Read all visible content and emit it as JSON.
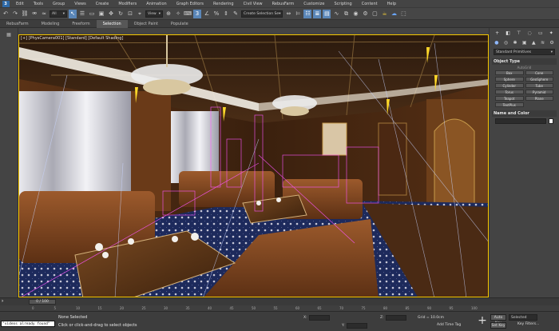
{
  "menu": [
    "Edit",
    "Tools",
    "Group",
    "Views",
    "Create",
    "Modifiers",
    "Animation",
    "Graph Editors",
    "Rendering",
    "Civil View",
    "RebusFarm",
    "Customize",
    "Scripting",
    "Content",
    "Help"
  ],
  "logo_text": "3",
  "toolbar": {
    "selection_filter": "All",
    "ref_coord": "View",
    "named_selection": "Create Selection Se"
  },
  "ribbon_tabs": [
    "RebusFarm",
    "Modeling",
    "Freeform",
    "Selection",
    "Object Paint",
    "Populate"
  ],
  "viewport": {
    "label": "[+] [PhysCamera001] [Standard] [Default Shading]"
  },
  "command_panel": {
    "dropdown": "Standard Primitives",
    "object_type_header": "Object Type",
    "autogrid": "AutoGrid",
    "objects": [
      "Box",
      "Cone",
      "Sphere",
      "GeoSphere",
      "Cylinder",
      "Tube",
      "Torus",
      "Pyramid",
      "Teapot",
      "Plane",
      "TextPlus"
    ],
    "name_color_header": "Name and Color"
  },
  "timeline": {
    "frame_display": "0 / 100",
    "ticks": [
      "0",
      "5",
      "10",
      "15",
      "20",
      "25",
      "30",
      "35",
      "40",
      "45",
      "50",
      "55",
      "60",
      "65",
      "70",
      "75",
      "80",
      "85",
      "90",
      "95",
      "100"
    ]
  },
  "status": {
    "maxscript": "\"videos already found\"",
    "line1": "None Selected",
    "line2": "Click or click-and-drag to select objects",
    "x_label": "X:",
    "y_label": "Y:",
    "z_label": "Z:",
    "grid": "Grid = 10.0cm",
    "add_time_tag": "Add Time Tag",
    "auto_key": "Auto Key",
    "set_key": "Set Key",
    "key_mode": "Selected",
    "key_filters": "Key Filters..."
  }
}
